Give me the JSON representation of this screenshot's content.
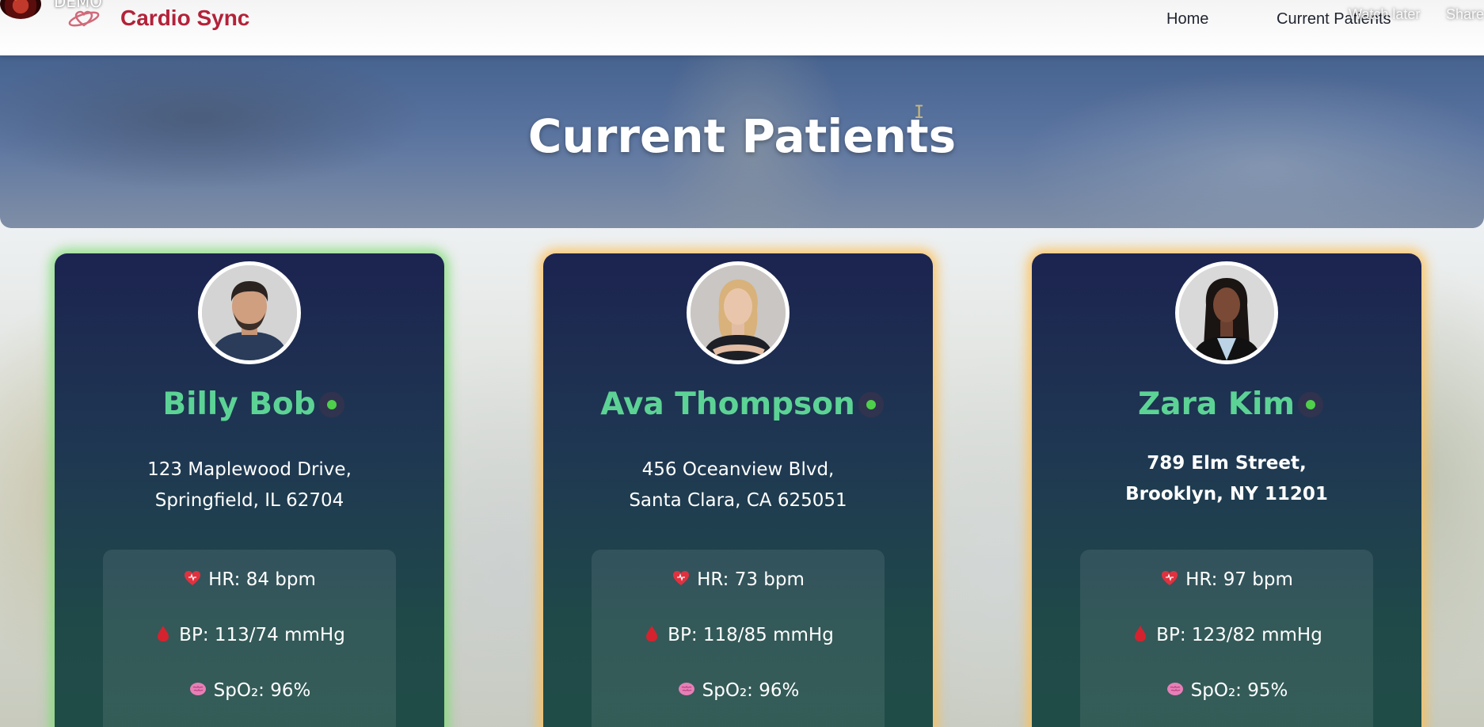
{
  "overlay": {
    "channel_label": "DEMO",
    "watch_later": "Watch later",
    "share": "Share"
  },
  "nav": {
    "brand": "Cardio Sync",
    "links": [
      "Home",
      "Current Patients"
    ]
  },
  "hero": {
    "title": "Current Patients"
  },
  "patients": [
    {
      "name": "Billy Bob",
      "address_line1": "123 Maplewood Drive,",
      "address_line2": "Springfield, IL 62704",
      "hr": "HR: 84 bpm",
      "bp": "BP: 113/74 mmHg",
      "spo2": "SpO₂: 96%",
      "highlight_color": "#78dc6e"
    },
    {
      "name": "Ava Thompson",
      "address_line1": "456 Oceanview Blvd,",
      "address_line2": "Santa Clara, CA 625051",
      "hr": "HR: 73 bpm",
      "bp": "BP: 118/85 mmHg",
      "spo2": "SpO₂: 96%",
      "highlight_color": "#ffbe50"
    },
    {
      "name": "Zara Kim",
      "address_line1": "789 Elm Street,",
      "address_line2": "Brooklyn, NY 11201",
      "hr": "HR: 97 bpm",
      "bp": "BP: 123/82 mmHg",
      "spo2": "SpO₂: 95%",
      "highlight_color": "#ffbe50"
    }
  ],
  "colors": {
    "brand": "#b3223a",
    "patient_name": "#5cd395",
    "status_online": "#4fd04a"
  },
  "icons": {
    "hr": "heart-icon",
    "bp": "blood-drop-icon",
    "spo2": "brain-icon",
    "logo": "heart-sync-logo-icon"
  }
}
